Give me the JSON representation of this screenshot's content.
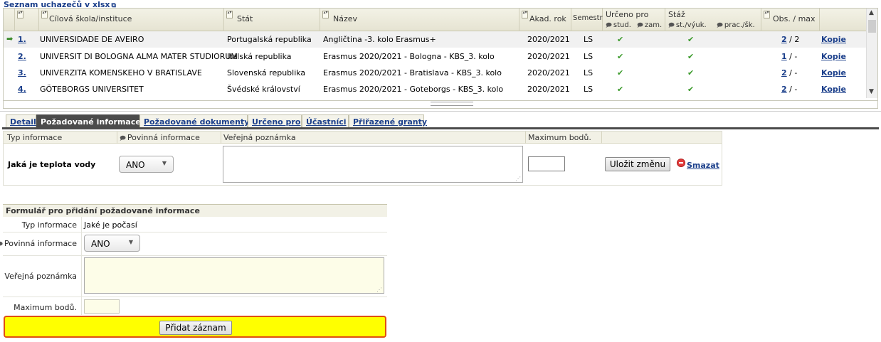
{
  "top_link": "Seznam uchazečů v xlsx",
  "grid": {
    "headers": {
      "school": "Cílová škola/instituce",
      "state": "Stát",
      "name": "Název",
      "year": "Akad. rok",
      "semester": "Semestr",
      "urceno": "Určeno pro",
      "urceno_stud": "stud.",
      "urceno_zam": "zam.",
      "staz": "Stáž",
      "staz_st": "st./výuk.",
      "staz_prac": "prac./šk.",
      "obs": "Obs. / max"
    },
    "rows": [
      {
        "num": "1.",
        "school": "UNIVERSIDADE DE AVEIRO",
        "state": "Portugalská republika",
        "name": "Angličtina -3. kolo Erasmus+",
        "year": "2020/2021",
        "semester": "LS",
        "obs": "2",
        "max": "/ 2",
        "copy": "Kopie"
      },
      {
        "num": "2.",
        "school": "UNIVERSIT DI BOLOGNA ALMA MATER STUDIORUM",
        "state": "Italská republika",
        "name": "Erasmus 2020/2021 - Bologna - KBS_3. kolo",
        "year": "2020/2021",
        "semester": "LS",
        "obs": "1",
        "max": "/ -",
        "copy": "Kopie"
      },
      {
        "num": "3.",
        "school": "UNIVERZITA KOMENSKEHO V BRATISLAVE",
        "state": "Slovenská republika",
        "name": "Erasmus 2020/2021 - Bratislava - KBS_3. kolo",
        "year": "2020/2021",
        "semester": "LS",
        "obs": "2",
        "max": "/ -",
        "copy": "Kopie"
      },
      {
        "num": "4.",
        "school": "GÖTEBORGS UNIVERSITET",
        "state": "Švédské království",
        "name": "Erasmus 2020/2021 - Goteborgs - KBS_3. kolo",
        "year": "2020/2021",
        "semester": "LS",
        "obs": "2",
        "max": "/ -",
        "copy": "Kopie"
      }
    ]
  },
  "tabs": [
    "Detail",
    "Požadované informace",
    "Požadované dokumenty",
    "Určeno pro",
    "Účastníci",
    "Přiřazené granty"
  ],
  "active_tab": "Požadované informace",
  "info": {
    "headers": {
      "type": "Typ informace",
      "required": "Povinná informace",
      "note": "Veřejná poznámka",
      "max": "Maximum bodů."
    },
    "row": {
      "type": "Jaká je teplota vody",
      "required": "ANO",
      "save": "Uložit změnu",
      "delete": "Smazat"
    }
  },
  "form": {
    "title": "Formulář pro přidání požadované informace",
    "type_label": "Typ informace",
    "type_value": "Jaké je počasí",
    "required_label": "Povinná informace",
    "required_value": "ANO",
    "note_label": "Veřejná poznámka",
    "max_label": "Maximum bodů.",
    "submit": "Přidat záznam"
  },
  "colors": {
    "link": "#1b3f8b",
    "active_tab": "#4b4b4b",
    "submit_bar": "#ffff00",
    "submit_border": "#e05010",
    "check": "#3a9a2a"
  }
}
